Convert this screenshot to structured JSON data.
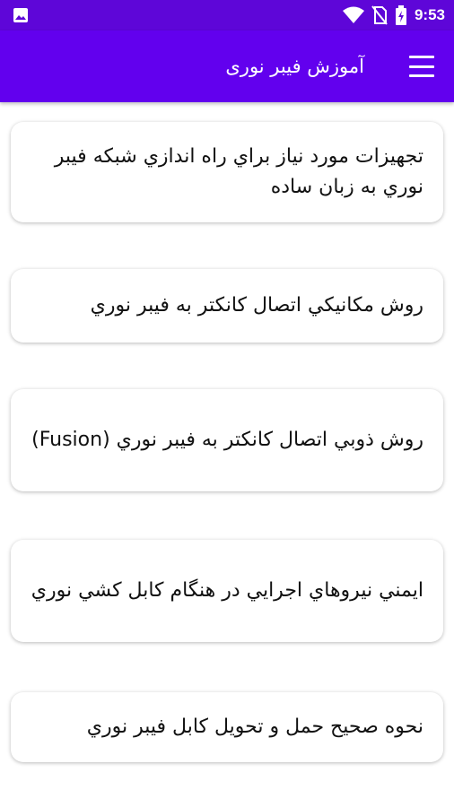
{
  "status_bar": {
    "time": "9:53",
    "icons": [
      "gallery-icon",
      "wifi-icon",
      "no-sim-icon",
      "battery-charging-icon"
    ]
  },
  "app_bar": {
    "title": "آموزش فیبر نوری",
    "menu_icon": "hamburger-menu-icon"
  },
  "articles": [
    "تجهيزات مورد نياز براي راه اندازي شبکه فيبر نوري به زبان ساده",
    "روش مکانيکي اتصال کانکتر به فيبر نوري",
    "روش ذوبي اتصال کانکتر به فيبر نوري (Fusion)",
    "ايمني نيروهاي اجرايي در هنگام کابل کشي نوري",
    "نحوه صحيح حمل و تحويل کابل فيبر نوري"
  ],
  "colors": {
    "status_bar": "#5e06d8",
    "app_bar": "#6200ee",
    "card_bg": "#ffffff",
    "text": "#111111"
  }
}
